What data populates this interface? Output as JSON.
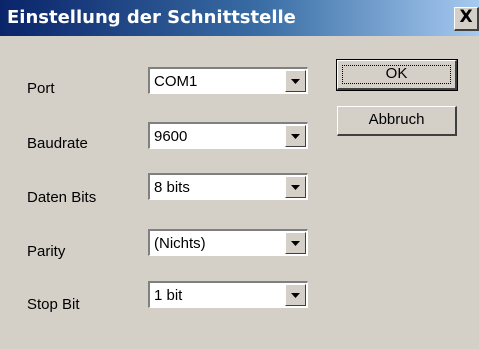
{
  "window": {
    "title": "Einstellung der Schnittstelle",
    "close_label": "X"
  },
  "fields": [
    {
      "label": "Port",
      "value": "COM1"
    },
    {
      "label": "Baudrate",
      "value": "9600"
    },
    {
      "label": "Daten Bits",
      "value": "8 bits"
    },
    {
      "label": "Parity",
      "value": "(Nichts)"
    },
    {
      "label": "Stop Bit",
      "value": "1 bit"
    }
  ],
  "buttons": {
    "ok_label": "OK",
    "cancel_label": "Abbruch"
  }
}
